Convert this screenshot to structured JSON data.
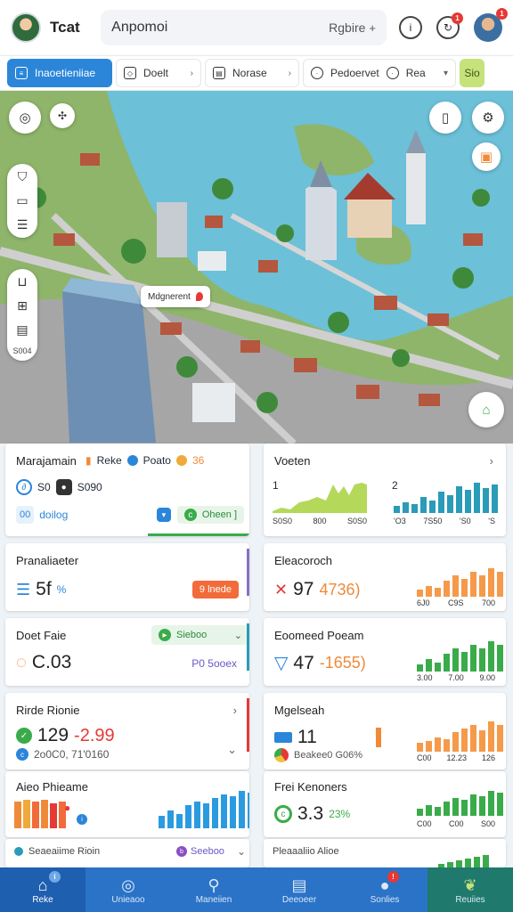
{
  "header": {
    "title": "Tcat",
    "search_text": "Anpomoi",
    "search_aside": "Rgbire",
    "search_arrow": "+",
    "icons": [
      "info-icon",
      "refresh-icon"
    ],
    "badge_count": "1",
    "avatar_badge": "1"
  },
  "filters": {
    "chips": [
      {
        "label": "Inaoetieniiae",
        "icon": "layers-icon"
      },
      {
        "label": "Doelt",
        "icon": "map-icon"
      },
      {
        "label": "Norase",
        "icon": "list-icon"
      },
      {
        "label": "Pedoervet",
        "icon": "target-icon"
      },
      {
        "label": "Rea",
        "icon": "clock-icon"
      }
    ],
    "go_label": "Sio"
  },
  "map": {
    "callout": "Mdgnerent",
    "side_label": "S004"
  },
  "cards": {
    "c1": {
      "title": "Marajamain",
      "legend": [
        "Reke",
        "Poato",
        "36"
      ],
      "row2_a": "S0",
      "row2_b": "S090",
      "row3_icon": "00",
      "row3_text": "doilog",
      "row3_pill": "Oheen ]"
    },
    "c2": {
      "title": "Voeten",
      "chev": "›",
      "label_a": "1",
      "label_b": "2",
      "ticks_a": [
        "S0S0",
        "800",
        "S0S0"
      ],
      "ticks_b": [
        "'O3",
        "7S50",
        "'S0",
        "'S"
      ]
    },
    "c3": {
      "title": "Pranaliaeter",
      "value": "5f",
      "unit": "%",
      "pill": "9 lnede"
    },
    "c4": {
      "title": "Eleacoroch",
      "value": "97",
      "delta": "4736)",
      "ticks": [
        "6J0",
        "C9S",
        "700"
      ]
    },
    "c5": {
      "title": "Doet Faie",
      "value": "C.03",
      "pill": "Sieboo",
      "sub": "P0 5ooex"
    },
    "c6": {
      "title": "Eoomeed Poeam",
      "value": "47",
      "delta": "-1655)",
      "ticks": [
        "3.00",
        "7.00",
        "9.00"
      ]
    },
    "c7": {
      "title": "Rirde Rionie",
      "value": "129",
      "delta": "-2.99",
      "sub": "2o0C0, 71'0160"
    },
    "c8": {
      "title": "Mgelseah",
      "value": "11",
      "sub": "Beakee0 G06%",
      "ticks": [
        "C00",
        "12.23",
        "126"
      ]
    },
    "c9": {
      "title": "Aieo Phieame"
    },
    "c10": {
      "title": "Frei Kenoners",
      "value": "3.3",
      "unit": "23%",
      "ticks": [
        "C00",
        "C00",
        "S00"
      ]
    },
    "c11": {
      "title": "Seaeaiime Rioin",
      "pill": "Seeboo"
    },
    "c12": {
      "title": "Pleaaaliio Alioe"
    }
  },
  "bottom_nav": [
    {
      "label": "Reke",
      "icon": "home-icon",
      "active": true
    },
    {
      "label": "Unieaoo",
      "icon": "compass-icon"
    },
    {
      "label": "Maneiien",
      "icon": "search-icon"
    },
    {
      "label": "Deeoeer",
      "icon": "document-icon"
    },
    {
      "label": "Sonlies",
      "icon": "user-icon"
    },
    {
      "label": "Reuiies",
      "icon": "leaf-icon"
    }
  ],
  "colors": {
    "primary": "#2b86d9",
    "nav": "#2a73c7",
    "lime": "#9ccc3b",
    "teal": "#2a9bb8",
    "orange": "#f08a3a",
    "green": "#3aab4a",
    "red": "#e53935"
  }
}
